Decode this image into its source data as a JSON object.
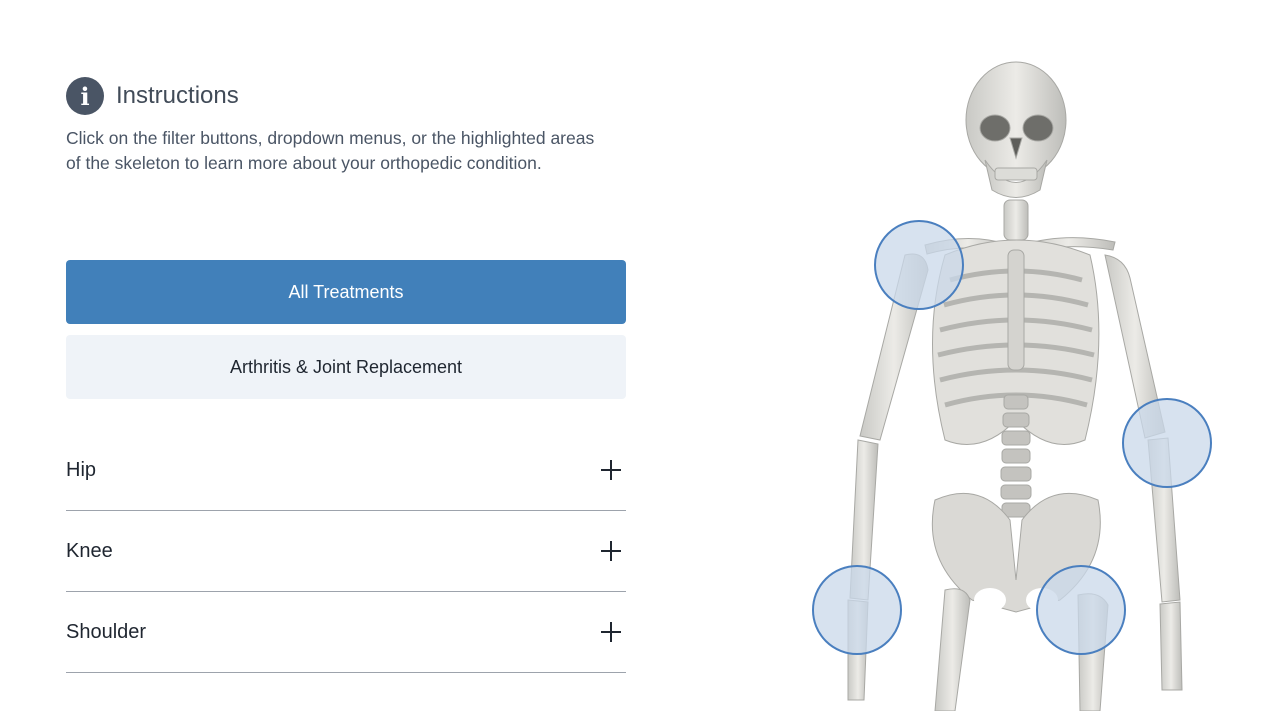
{
  "instructions": {
    "title": "Instructions",
    "icon": "info-icon",
    "text": "Click on the filter buttons, dropdown menus, or the highlighted areas of the skeleton to learn more about your orthopedic condition."
  },
  "filters": {
    "all_label": "All Treatments",
    "arthritis_label": "Arthritis & Joint Replacement"
  },
  "accordion": [
    {
      "label": "Hip"
    },
    {
      "label": "Knee"
    },
    {
      "label": "Shoulder"
    }
  ],
  "colors": {
    "primary": "#4180ba",
    "secondary_bg": "#eff3f8",
    "hotspot_stroke": "#4a7fbf",
    "hotspot_fill": "#c9d8ea"
  },
  "hotspots": [
    "shoulder",
    "elbow",
    "wrist",
    "hip"
  ]
}
